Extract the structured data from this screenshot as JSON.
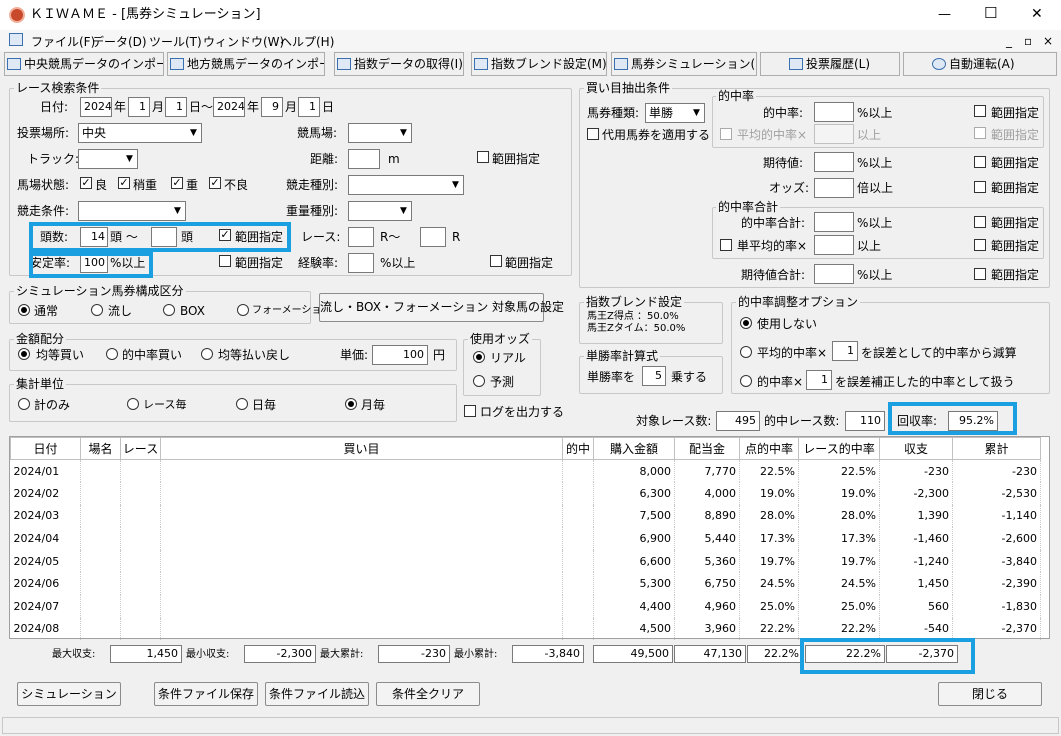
{
  "window": {
    "title": "ＫＩＷＡＭＥ - [馬券シミュレーション]",
    "min": "—",
    "max": "☐",
    "close": "✕"
  },
  "menu": [
    "ファイル(F)",
    "データ(D)",
    "ツール(T)",
    "ウィンドウ(W)",
    "ヘルプ(H)"
  ],
  "toolbar": [
    "中央競馬データのインポート(J)",
    "地方競馬データのインポート(N)",
    "指数データの取得(I)",
    "指数ブレンド設定(M)",
    "馬券シミュレーション(B)",
    "投票履歴(L)",
    "自動運転(A)"
  ],
  "race_search": {
    "group_title": "レース検索条件",
    "date_label": "日付:",
    "from_year": "2024",
    "year_unit": "年",
    "from_month": "1",
    "month_unit": "月",
    "from_day": "1",
    "day_unit": "日〜",
    "to_year": "2024",
    "to_month": "9",
    "to_day": "1",
    "to_day_unit": "日",
    "venue_label": "投票場所:",
    "venue_value": "中央",
    "track_label": "競馬場:",
    "trackcond_label": "トラック:",
    "distance_label": "距離:",
    "distance_unit": "m",
    "range_label": "範囲指定",
    "baba_label": "馬場状態:",
    "baba_options": [
      "良",
      "稍重",
      "重",
      "不良"
    ],
    "race_type_label": "競走種別:",
    "race_cond_label": "競走条件:",
    "weight_type_label": "重量種別:",
    "heads_label": "頭数:",
    "heads_from": "14",
    "heads_unit_from": "頭 〜",
    "heads_unit_to": "頭",
    "heads_range": "範囲指定",
    "race_label": "レース:",
    "race_unit_from": "R〜",
    "race_unit_to": "R",
    "stable_label": "安定率:",
    "stable_value": "100",
    "stable_unit": "%以上",
    "stable_range": "範囲指定",
    "exp_label": "経験率:",
    "exp_unit": "%以上",
    "exp_range": "範囲指定"
  },
  "sim_compose": {
    "group_title": "シミュレーション馬券構成区分",
    "options": [
      "通常",
      "流し",
      "BOX",
      "フォーメーション"
    ],
    "button": "流し・BOX・フォーメーション 対象馬の設定"
  },
  "amount": {
    "group_title": "金額配分",
    "options": [
      "均等買い",
      "的中率買い",
      "均等払い戻し"
    ],
    "unit_label": "単価:",
    "unit_value": "100",
    "unit_yen": "円"
  },
  "odds": {
    "group_title": "使用オッズ",
    "options": [
      "リアル",
      "予測"
    ]
  },
  "aggregate": {
    "group_title": "集計単位",
    "options": [
      "計のみ",
      "レース毎",
      "日毎",
      "月毎"
    ]
  },
  "log_label": "ログを出力する",
  "buy": {
    "group_title": "買い目抽出条件",
    "type_label": "馬券種類:",
    "type_value": "単勝",
    "alt_label": "代用馬券を適用する",
    "hit_group": "的中率",
    "hit_label": "的中率:",
    "hit_unit": "%以上",
    "avg_hit_label": "平均的中率×",
    "avg_hit_unit": "以上",
    "exp_label": "期待値:",
    "exp_unit": "%以上",
    "odds_label": "オッズ:",
    "odds_unit": "倍以上",
    "sum_group": "的中率合計",
    "sum_label": "的中率合計:",
    "sum_unit": "%以上",
    "single_avg_label": "単平均的率×",
    "single_avg_unit": "以上",
    "exp_sum_label": "期待値合計:",
    "exp_sum_unit": "%以上",
    "range_label": "範囲指定"
  },
  "blend": {
    "group_title": "指数ブレンド設定",
    "line1": "馬王Z得点 ：50.0%",
    "line2": "馬王Zタイム：50.0%"
  },
  "tansho": {
    "group_title": "単勝率計算式",
    "label": "単勝率を",
    "value": "5",
    "unit": "乗する"
  },
  "adjust": {
    "group_title": "的中率調整オプション",
    "opt1": "使用しない",
    "opt2a": "平均的中率×",
    "opt2v": "1",
    "opt2b": "を誤差として的中率から減算",
    "opt3a": "的中率×",
    "opt3v": "1",
    "opt3b": "を誤差補正した的中率として扱う"
  },
  "summary": {
    "target_label": "対象レース数:",
    "target_value": "495",
    "hit_label": "的中レース数:",
    "hit_value": "110",
    "recovery_label": "回収率:",
    "recovery_value": "95.2%"
  },
  "table": {
    "headers": [
      "日付",
      "場名",
      "レース",
      "買い目",
      "的中",
      "購入金額",
      "配当金",
      "点的中率",
      "レース的中率",
      "収支",
      "累計"
    ],
    "rows": [
      [
        "2024/01",
        "",
        "",
        "",
        "",
        "8,000",
        "7,770",
        "22.5%",
        "22.5%",
        "-230",
        "-230"
      ],
      [
        "2024/02",
        "",
        "",
        "",
        "",
        "6,300",
        "4,000",
        "19.0%",
        "19.0%",
        "-2,300",
        "-2,530"
      ],
      [
        "2024/03",
        "",
        "",
        "",
        "",
        "7,500",
        "8,890",
        "28.0%",
        "28.0%",
        "1,390",
        "-1,140"
      ],
      [
        "2024/04",
        "",
        "",
        "",
        "",
        "6,900",
        "5,440",
        "17.3%",
        "17.3%",
        "-1,460",
        "-2,600"
      ],
      [
        "2024/05",
        "",
        "",
        "",
        "",
        "6,600",
        "5,360",
        "19.7%",
        "19.7%",
        "-1,240",
        "-3,840"
      ],
      [
        "2024/06",
        "",
        "",
        "",
        "",
        "5,300",
        "6,750",
        "24.5%",
        "24.5%",
        "1,450",
        "-2,390"
      ],
      [
        "2024/07",
        "",
        "",
        "",
        "",
        "4,400",
        "4,960",
        "25.0%",
        "25.0%",
        "560",
        "-1,830"
      ],
      [
        "2024/08",
        "",
        "",
        "",
        "",
        "4,500",
        "3,960",
        "22.2%",
        "22.2%",
        "-540",
        "-2,370"
      ]
    ]
  },
  "totals": {
    "max_income_label": "最大収支:",
    "max_income": "1,450",
    "min_income_label": "最小収支:",
    "min_income": "-2,300",
    "max_cum_label": "最大累計:",
    "max_cum": "-230",
    "min_cum_label": "最小累計:",
    "min_cum": "-3,840",
    "buy_total": "49,500",
    "pay_total": "47,130",
    "pt_hit": "22.2%",
    "race_hit": "22.2%",
    "balance": "-2,370"
  },
  "buttons": {
    "simulate": "シミュレーション",
    "save": "条件ファイル保存",
    "load": "条件ファイル読込",
    "clear": "条件全クリア",
    "close": "閉じる"
  }
}
